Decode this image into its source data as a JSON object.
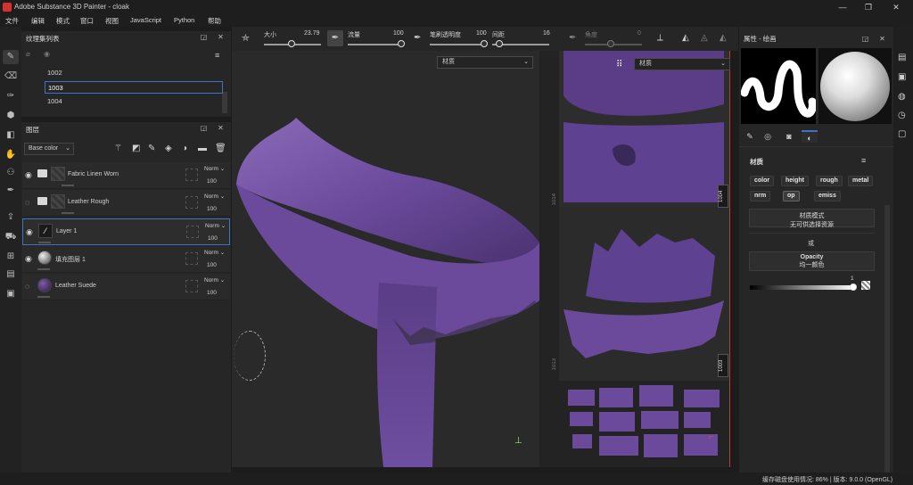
{
  "window": {
    "title": "Adobe Substance 3D Painter - cloak",
    "minimize": "—",
    "maximize": "❐",
    "close": "✕"
  },
  "menu": [
    "文件",
    "编辑",
    "模式",
    "窗口",
    "视图",
    "JavaScript",
    "Python",
    "帮助"
  ],
  "left_tools": [
    "paint-brush-icon",
    "eraser-icon",
    "projection-icon",
    "polygon-fill-icon",
    "smudge-icon",
    "clone-icon",
    "material-picker-icon",
    "bake-icon",
    "geometry-icon",
    "selection-icon",
    "color-picker-icon",
    "export-icon",
    "bake-mesh-icon",
    "shelf-icon",
    "3d-icon"
  ],
  "texture_sets": {
    "title": "纹理集列表",
    "items": [
      "1002",
      "1003",
      "1004"
    ],
    "selected": "1003"
  },
  "layers": {
    "title": "图层",
    "channel_select": "Base color",
    "items": [
      {
        "name": "Fabric Linen Worn",
        "type": "folder",
        "blend": "Norm",
        "opacity": "100",
        "visible": true
      },
      {
        "name": "Leather Rough",
        "type": "folder",
        "blend": "Norm",
        "opacity": "100",
        "visible": false
      },
      {
        "name": "Layer 1",
        "type": "paint",
        "blend": "Norm",
        "opacity": "100",
        "visible": true,
        "selected": true
      },
      {
        "name": "填充图层 1",
        "type": "fill",
        "blend": "Norm",
        "opacity": "100",
        "visible": true
      },
      {
        "name": "Leather Suede",
        "type": "material",
        "blend": "Norm",
        "opacity": "100",
        "visible": false
      }
    ]
  },
  "toolbar": {
    "size_label": "大小",
    "size_value": "23.79",
    "flow_label": "流量",
    "flow_value": "100",
    "opacity_label": "笔刷透明度",
    "opacity_value": "100",
    "spacing_label": "间距",
    "spacing_value": "16",
    "angle_label": "角度",
    "angle_value": "0"
  },
  "viewport": {
    "mode_3d": "材质",
    "mode_2d": "材质",
    "uv_labels": [
      "1004",
      "1003"
    ],
    "uv_side_labels": [
      "1014",
      "1013"
    ]
  },
  "properties": {
    "title": "属性 - 绘画",
    "section_title": "材质",
    "channels": [
      "color",
      "height",
      "rough",
      "metal",
      "nrm",
      "op",
      "emiss"
    ],
    "active_channel": "op",
    "material_mode_label": "材质模式",
    "material_mode_value": "无可供选择资源",
    "or_label": "或",
    "opacity_title": "Opacity",
    "opacity_sub": "均一颜色",
    "opacity_value": "1"
  },
  "right_tools": [
    "layers-panel-icon",
    "display-settings-icon",
    "environment-icon",
    "history-icon",
    "log-icon"
  ],
  "status": {
    "text": "缓存磁盘使用情况: 86% | 版本: 9.0.0 (OpenGL)"
  },
  "colors": {
    "accent": "#3f74c4",
    "fabric": "#6b4a9c",
    "red_line": "#c0392b"
  }
}
